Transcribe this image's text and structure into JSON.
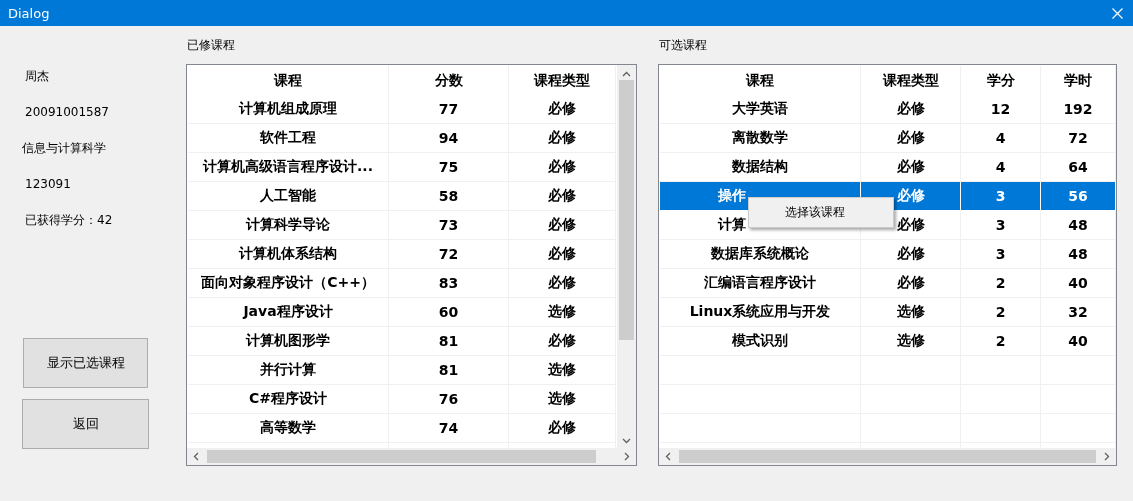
{
  "window": {
    "title": "Dialog"
  },
  "student": {
    "name": "周杰",
    "number": "20091001587",
    "major": "信息与计算科学",
    "class": "123091",
    "credits": "已获得学分：42"
  },
  "buttons": [
    "显示已选课程",
    "返回"
  ],
  "completed": {
    "title": "已修课程",
    "columns": [
      "课程",
      "分数",
      "课程类型"
    ],
    "rows": [
      [
        "计算机组成原理",
        "77",
        "必修"
      ],
      [
        "软件工程",
        "94",
        "必修"
      ],
      [
        "计算机高级语言程序设计...",
        "75",
        "必修"
      ],
      [
        "人工智能",
        "58",
        "必修"
      ],
      [
        "计算科学导论",
        "73",
        "必修"
      ],
      [
        "计算机体系结构",
        "72",
        "必修"
      ],
      [
        "面向对象程序设计（C++）",
        "83",
        "必修"
      ],
      [
        "Java程序设计",
        "60",
        "选修"
      ],
      [
        "计算机图形学",
        "81",
        "必修"
      ],
      [
        "并行计算",
        "81",
        "选修"
      ],
      [
        "C#程序设计",
        "76",
        "选修"
      ],
      [
        "高等数学",
        "74",
        "必修"
      ]
    ]
  },
  "available": {
    "title": "可选课程",
    "columns": [
      "课程",
      "课程类型",
      "学分",
      "学时"
    ],
    "rows": [
      {
        "kind": "plain",
        "cells": [
          "大学英语",
          "必修",
          "12",
          "192"
        ],
        "selected": false
      },
      {
        "kind": "plain",
        "cells": [
          "离散数学",
          "必修",
          "4",
          "72"
        ],
        "selected": false
      },
      {
        "kind": "plain",
        "cells": [
          "数据结构",
          "必修",
          "4",
          "64"
        ],
        "selected": false
      },
      {
        "kind": "covered",
        "cells": [
          "操作",
          "必修",
          "3",
          "56"
        ],
        "selected": true
      },
      {
        "kind": "covered",
        "cells": [
          "计算",
          "必修",
          "3",
          "48"
        ],
        "selected": false
      },
      {
        "kind": "plain",
        "cells": [
          "数据库系统概论",
          "必修",
          "3",
          "48"
        ],
        "selected": false
      },
      {
        "kind": "plain",
        "cells": [
          "汇编语言程序设计",
          "必修",
          "2",
          "40"
        ],
        "selected": false
      },
      {
        "kind": "plain",
        "cells": [
          "Linux系统应用与开发",
          "选修",
          "2",
          "32"
        ],
        "selected": false
      },
      {
        "kind": "plain",
        "cells": [
          "模式识别",
          "选修",
          "2",
          "40"
        ],
        "selected": false
      }
    ]
  },
  "context_menu": {
    "items": [
      "选择该课程"
    ]
  }
}
